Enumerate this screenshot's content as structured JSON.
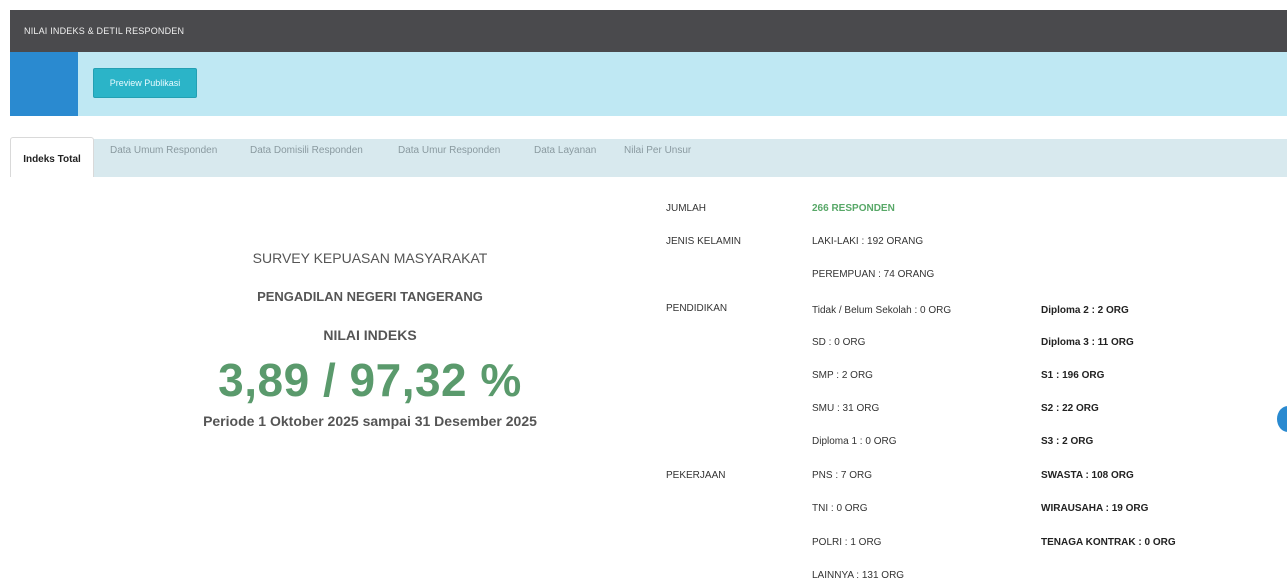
{
  "header": {
    "title": "NILAI INDEKS & DETIL RESPONDEN"
  },
  "toolbar": {
    "preview_label": "Preview Publikasi"
  },
  "tabs": [
    {
      "label": "Indeks Total",
      "active": true
    },
    {
      "label": "Data Umum Responden"
    },
    {
      "label": "Data Domisili Responden"
    },
    {
      "label": "Data Umur Responden"
    },
    {
      "label": "Data Layanan"
    },
    {
      "label": "Nilai Per Unsur"
    }
  ],
  "summary": {
    "line1": "SURVEY KEPUASAN MASYARAKAT",
    "line2": "PENGADILAN NEGERI TANGERANG",
    "line3": "NILAI INDEKS",
    "value": "3,89 / 97,32 %",
    "period": "Periode 1 Oktober 2025 sampai 31 Desember 2025"
  },
  "details": {
    "jumlah_label": "JUMLAH",
    "jumlah_value": "266 RESPONDEN",
    "gender_label": "JENIS KELAMIN",
    "gender": [
      "LAKI-LAKI : 192 ORANG",
      "PEREMPUAN : 74 ORANG"
    ],
    "education_label": "PENDIDIKAN",
    "education_col1": [
      "Tidak / Belum Sekolah : 0 ORG",
      "SD : 0 ORG",
      "SMP : 2 ORG",
      "SMU : 31 ORG",
      "Diploma 1 : 0 ORG"
    ],
    "education_col2": [
      "Diploma 2 : 2 ORG",
      "Diploma 3 : 11 ORG",
      "S1 : 196 ORG",
      "S2 : 22 ORG",
      "S3 : 2 ORG"
    ],
    "job_label": "PEKERJAAN",
    "job_col1": [
      "PNS : 7 ORG",
      "TNI : 0 ORG",
      "POLRI : 1 ORG",
      "LAINNYA : 131 ORG"
    ],
    "job_col2": [
      "SWASTA : 108 ORG",
      "WIRAUSAHA : 19 ORG",
      "TENAGA KONTRAK : 0 ORG"
    ]
  },
  "colors": {
    "accent_blue": "#2a8ad0",
    "light_blue": "#bfe8f3",
    "green": "#5a9a6c",
    "dark_header": "#4a4a4d"
  }
}
